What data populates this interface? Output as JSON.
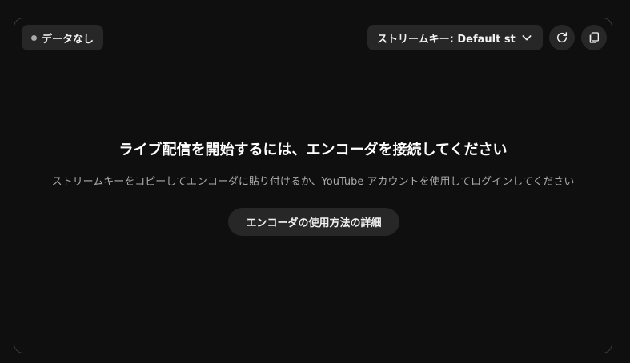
{
  "status": {
    "label": "データなし",
    "dot_color": "#aaaaaa"
  },
  "stream_key": {
    "selected": "ストリームキー: Default stream key",
    "icon": "chevron-down-icon"
  },
  "actions": {
    "refresh_icon": "refresh-icon",
    "copy_icon": "copy-icon"
  },
  "main": {
    "heading": "ライブ配信を開始するには、エンコーダを接続してください",
    "description": "ストリームキーをコピーしてエンコーダに貼り付けるか、YouTube アカウントを使用してログインしてください",
    "learn_button": "エンコーダの使用方法の詳細"
  },
  "colors": {
    "background": "#0f0f0f",
    "surface": "#272727",
    "border": "#3a3a3a",
    "text_primary": "#ffffff",
    "text_secondary": "#aaaaaa"
  }
}
